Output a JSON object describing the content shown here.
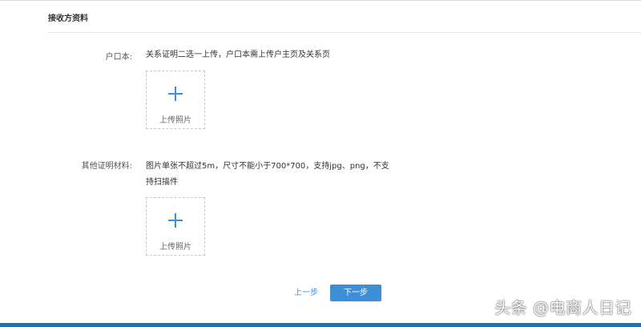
{
  "section": {
    "title": "接收方资料"
  },
  "household": {
    "label": "户口本:",
    "hint": "关系证明二选一上传，户口本需上传户主页及关系页",
    "upload_label": "上传照片"
  },
  "other_docs": {
    "label": "其他证明材料:",
    "hint_line1": "图片单张不超过5m，尺寸不能小于700*700，支持jpg、png，不支",
    "hint_line2": "持扫描件",
    "upload_label": "上传照片"
  },
  "actions": {
    "prev_label": "上一步",
    "next_label": "下一步"
  },
  "watermark": {
    "text": "头条 @电商人日记"
  },
  "colors": {
    "accent": "#3d8fd8",
    "bottom_bar": "#1e6fb8"
  }
}
